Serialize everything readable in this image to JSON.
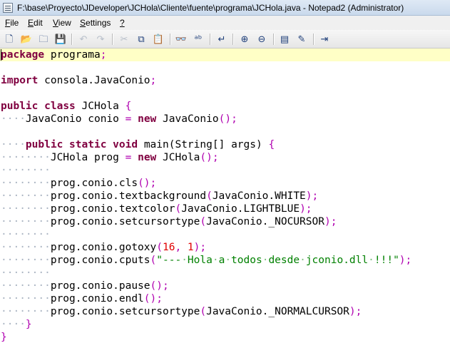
{
  "window": {
    "title": "F:\\base\\Proyecto\\JDeveloper\\JCHola\\Cliente\\fuente\\programa\\JCHola.java - Notepad2 (Administrator)"
  },
  "menu": [
    {
      "accel": "F",
      "rest": "ile"
    },
    {
      "accel": "E",
      "rest": "dit"
    },
    {
      "accel": "V",
      "rest": "iew"
    },
    {
      "accel": "S",
      "rest": "ettings"
    },
    {
      "accel": "?",
      "rest": ""
    }
  ],
  "toolbar": {
    "new": "🗋",
    "open": "📂",
    "browse": "🗀",
    "save": "💾",
    "undo": "↶",
    "redo": "↷",
    "cut": "✂",
    "copy": "⧉",
    "paste": "📋",
    "find": "👓",
    "replace": "ᵃᵇ",
    "wordwrap": "↵",
    "zoom_in": "⊕",
    "zoom_out": "⊖",
    "scheme": "▤",
    "customize": "✎",
    "exit": "⇥"
  },
  "colors": {
    "keyword": "#800040",
    "operator": "#b000b0",
    "number": "#e00000",
    "string": "#008000",
    "whitespace": "#aab4c2",
    "current_line": "#ffffc6"
  },
  "code": {
    "l1": [
      "package",
      " ",
      "programa",
      ";"
    ],
    "l3": [
      "import",
      " ",
      "consola.JavaConio",
      ";"
    ],
    "l5": [
      "public",
      " ",
      "class",
      " ",
      "JCHola",
      " ",
      "{"
    ],
    "l6": [
      "····",
      "JavaConio",
      " ",
      "conio",
      " ",
      "=",
      " ",
      "new",
      " ",
      "JavaConio",
      "();"
    ],
    "l8": [
      "····",
      "public",
      " ",
      "static",
      " ",
      "void",
      " ",
      "main(String[]",
      " ",
      "args)",
      " ",
      "{"
    ],
    "l9": [
      "········",
      "JCHola",
      " ",
      "prog",
      " ",
      "=",
      " ",
      "new",
      " ",
      "JCHola",
      "();"
    ],
    "l10": [
      "········"
    ],
    "l11": [
      "········",
      "prog.conio.cls",
      "();"
    ],
    "l12": [
      "········",
      "prog.conio.textbackground",
      "(",
      "JavaConio.WHITE",
      ");"
    ],
    "l13": [
      "········",
      "prog.conio.textcolor",
      "(",
      "JavaConio.LIGHTBLUE",
      ");"
    ],
    "l14": [
      "········",
      "prog.conio.setcursortype",
      "(",
      "JavaConio._NOCURSOR",
      ");"
    ],
    "l15": [
      "········"
    ],
    "l16": [
      "········",
      "prog.conio.gotoxy",
      "(",
      "16",
      ",",
      " ",
      "1",
      ");"
    ],
    "l17": [
      "········",
      "prog.conio.cputs",
      "(",
      "\"---",
      "·",
      "Hola",
      "·",
      "a",
      "·",
      "todos",
      "·",
      "desde",
      "·",
      "jconio.dll",
      "·",
      "!!!\"",
      ");"
    ],
    "l18": [
      "········"
    ],
    "l19": [
      "········",
      "prog.conio.pause",
      "();"
    ],
    "l20": [
      "········",
      "prog.conio.endl",
      "();"
    ],
    "l21": [
      "········",
      "prog.conio.setcursortype",
      "(",
      "JavaConio._NORMALCURSOR",
      ");"
    ],
    "l22": [
      "····",
      "}"
    ],
    "l23": [
      "}"
    ]
  }
}
